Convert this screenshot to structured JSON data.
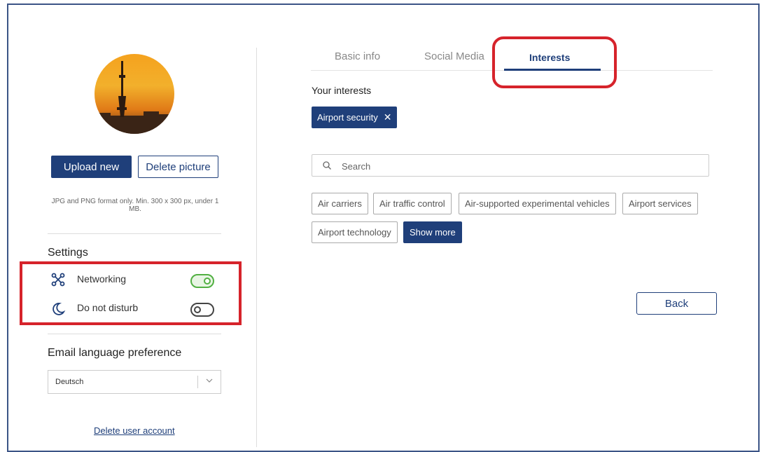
{
  "profile": {
    "upload_label": "Upload new",
    "delete_picture_label": "Delete picture",
    "hint": "JPG and PNG format only. Min. 300 x 300 px, under 1 MB."
  },
  "settings": {
    "title": "Settings",
    "networking_label": "Networking",
    "networking_on": true,
    "dnd_label": "Do not disturb",
    "dnd_on": false
  },
  "email": {
    "title": "Email language preference",
    "selected": "Deutsch"
  },
  "delete_account_label": "Delete user account",
  "tabs": [
    {
      "label": "Basic info",
      "active": false
    },
    {
      "label": "Social Media",
      "active": false
    },
    {
      "label": "Interests",
      "active": true
    }
  ],
  "interests": {
    "title": "Your interests",
    "selected": [
      "Airport security"
    ],
    "search_placeholder": "Search",
    "suggestions": [
      "Air carriers",
      "Air traffic control",
      "Air-supported experimental vehicles",
      "Airport services",
      "Airport technology"
    ],
    "show_more_label": "Show more"
  },
  "back_label": "Back",
  "colors": {
    "accent": "#1f3f7a",
    "toggle_on": "#52b043",
    "highlight": "#d6232b"
  }
}
